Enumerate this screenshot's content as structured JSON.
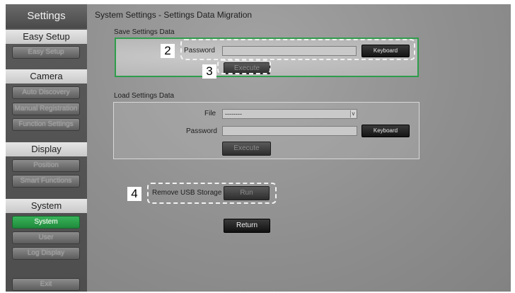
{
  "sidebar": {
    "title": "Settings",
    "sections": {
      "easy_setup": "Easy Setup",
      "camera": "Camera",
      "display": "Display",
      "system": "System"
    },
    "buttons": {
      "easy_setup": "Easy Setup",
      "auto_discovery": "Auto Discovery",
      "manual_registration": "Manual Registration",
      "function_settings": "Function Settings",
      "position": "Position",
      "smart_functions": "Smart Functions",
      "system": "System",
      "user": "User",
      "log_display": "Log Display",
      "exit": "Exit"
    }
  },
  "main": {
    "title": "System Settings - Settings Data Migration",
    "save": {
      "label": "Save Settings Data",
      "password_label": "Password",
      "password_value": "",
      "keyboard": "Keyboard",
      "execute": "Execute"
    },
    "load": {
      "label": "Load Settings Data",
      "file_label": "File",
      "file_value": "--------",
      "caret": "v",
      "password_label": "Password",
      "password_value": "",
      "keyboard": "Keyboard",
      "execute": "Execute"
    },
    "remove_usb": {
      "label": "Remove USB Storage",
      "run": "Run"
    },
    "return": "Return"
  },
  "callouts": {
    "c2": "2",
    "c3": "3",
    "c4": "4"
  },
  "colors": {
    "accent_green": "#2f9d4c",
    "active_green": "#39b35a"
  }
}
